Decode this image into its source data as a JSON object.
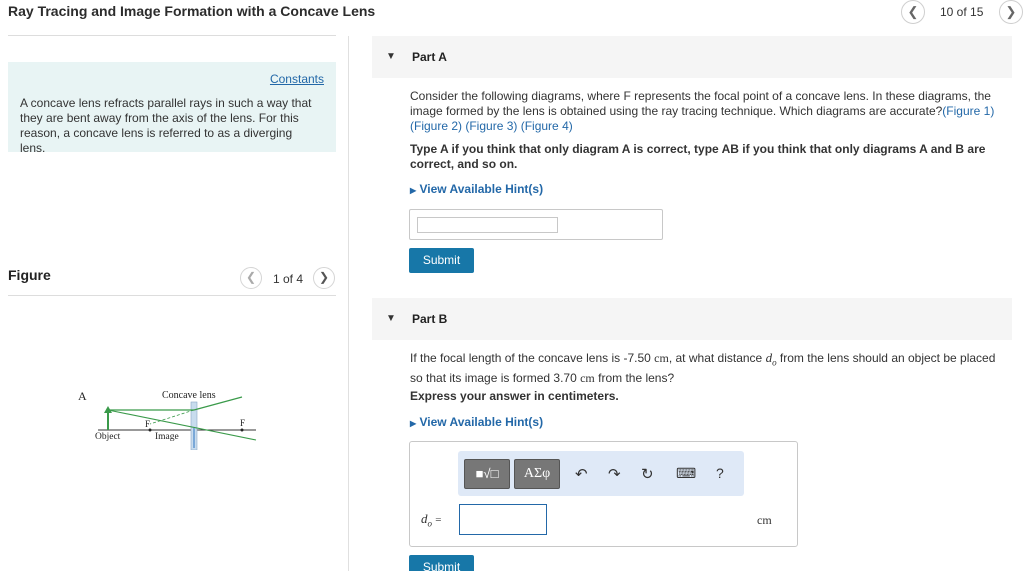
{
  "header": {
    "title": "Ray Tracing and Image Formation with a Concave Lens",
    "page_counter": "10 of 15",
    "prev_icon": "chevron-left-icon",
    "next_icon": "chevron-right-icon"
  },
  "left_panel": {
    "constants_link": "Constants",
    "intro_text": "A concave lens refracts parallel rays in such a way that they are bent away from the axis of the lens. For this reason, a concave lens is referred to as a diverging lens.",
    "figure_label": "Figure",
    "figure_counter": "1 of 4",
    "diagram": {
      "letter": "A",
      "lens_label": "Concave lens",
      "object_label": "Object",
      "image_label": "Image",
      "f_left": "F",
      "f_right": "F"
    }
  },
  "part_a": {
    "header": "Part A",
    "question_pre": "Consider the following diagrams, where F represents the focal point of a concave lens. In these diagrams, the image formed by the lens is obtained using the ray tracing technique. Which diagrams are accurate?",
    "figure_links": [
      "(Figure 1)",
      "(Figure 2)",
      "(Figure 3)",
      "(Figure 4)"
    ],
    "instruction": "Type A if you think that only diagram A is correct, type AB if you think that only diagrams A and B are correct, and so on.",
    "hint_link": "View Available Hint(s)",
    "input_value": "",
    "submit_label": "Submit"
  },
  "part_b": {
    "header": "Part B",
    "question_1": "If the focal length of the concave lens is -7.50",
    "unit_1": "cm",
    "question_2": ", at what distance",
    "var_inline": "d",
    "var_sub": "o",
    "question_3": "from the lens should an object be placed so that its image is formed 3.70",
    "unit_2": "cm",
    "question_4": "from the lens?",
    "instruction": "Express your answer in centimeters.",
    "hint_link": "View Available Hint(s)",
    "toolbar": {
      "template_button": "■√□",
      "greek_button": "ΑΣφ",
      "undo_icon": "undo-icon",
      "redo_icon": "redo-icon",
      "reset_icon": "reset-icon",
      "keyboard_icon": "keyboard-icon",
      "help_label": "?"
    },
    "var_label": "d",
    "var_label_sub": "o",
    "equals": "=",
    "input_value": "",
    "unit_label": "cm",
    "submit_label": "Submit"
  },
  "colors": {
    "link_blue": "#2368a8",
    "submit_bg": "#1777a8",
    "constants_bg": "#e8f4f4",
    "toolbar_bg": "#dfe9f7",
    "ray_green": "#3a9a4a",
    "image_blue": "#7aa8d8"
  }
}
